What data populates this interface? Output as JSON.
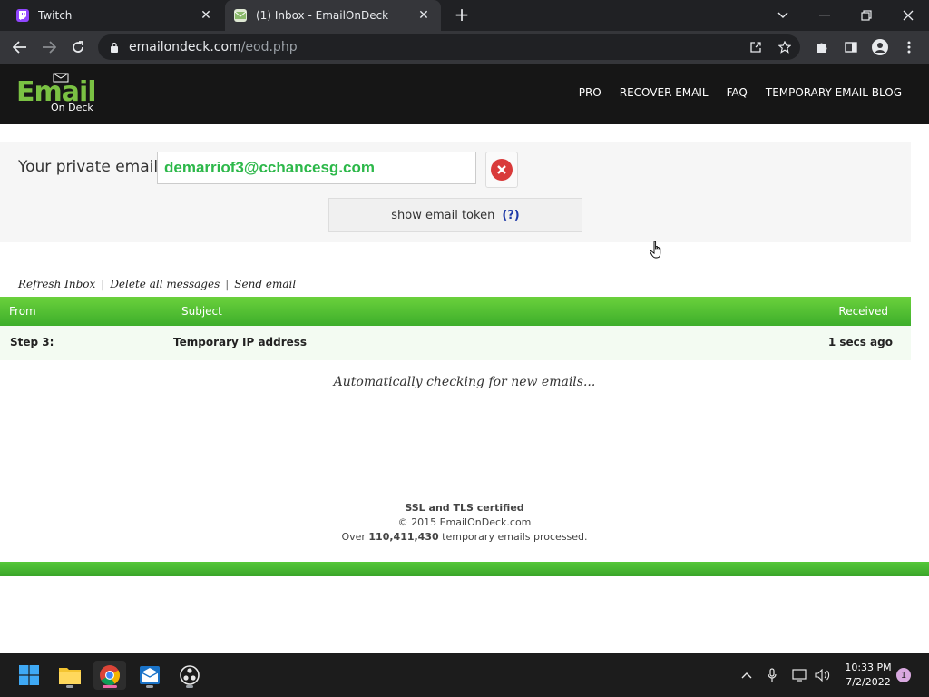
{
  "browser": {
    "tabs": [
      {
        "title": "Twitch",
        "favicon": "twitch-icon",
        "active": false
      },
      {
        "title": "(1) Inbox - EmailOnDeck",
        "favicon": "emailondeck-favicon",
        "active": true
      }
    ],
    "url_host": "emailondeck.com",
    "url_path": "/eod.php"
  },
  "site": {
    "logo_main": "Email",
    "logo_sub": "On Deck",
    "nav": [
      "PRO",
      "RECOVER EMAIL",
      "FAQ",
      "TEMPORARY EMAIL BLOG"
    ]
  },
  "email_panel": {
    "label": "Your private email",
    "address": "demarriof3@cchancesg.com",
    "token_button": "show email token",
    "token_help": "(?)"
  },
  "actions": [
    "Refresh Inbox",
    "Delete all messages",
    "Send email"
  ],
  "table": {
    "headers": {
      "from": "From",
      "subject": "Subject",
      "received": "Received"
    },
    "rows": [
      {
        "from": "Step 3:",
        "subject": "Temporary IP address",
        "received": "1 secs ago"
      }
    ]
  },
  "status": "Automatically checking for new emails...",
  "footer": {
    "cert": "SSL and TLS certified",
    "copyright": "© 2015 EmailOnDeck.com",
    "processed_prefix": "Over",
    "processed_count": "110,411,430",
    "processed_suffix": "temporary emails processed."
  },
  "taskbar": {
    "time": "10:33 PM",
    "date": "7/2/2022",
    "notifications": "1"
  },
  "colors": {
    "accent_green": "#3dae2b",
    "email_text": "#2db84a",
    "header_bg": "#161616"
  }
}
